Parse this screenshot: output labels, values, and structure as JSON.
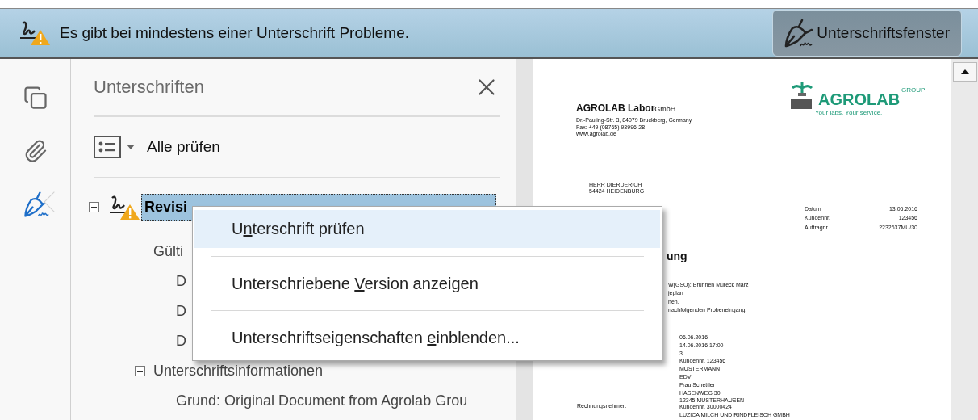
{
  "banner": {
    "message": "Es gibt bei mindestens einer Unterschrift Probleme.",
    "button": "Unterschriftsfenster"
  },
  "rail": [
    {
      "kind": "pages",
      "selected": false
    },
    {
      "kind": "attachments",
      "selected": false
    },
    {
      "kind": "signatures",
      "selected": true
    }
  ],
  "panel": {
    "title": "Unterschriften",
    "toolbar": {
      "label": "Alle prüfen"
    },
    "tree": [
      {
        "label": "Revisi",
        "selected": true,
        "expanded": true,
        "warning": true,
        "children": [
          {
            "label": "Gülti",
            "children": [
              {
                "label": "D"
              },
              {
                "label": "D"
              },
              {
                "label": "D"
              }
            ]
          },
          {
            "label": "Unterschriftsinformationen",
            "expanded": true,
            "children": [
              {
                "label": "Grund: Original Document from Agrolab Grou"
              }
            ]
          }
        ]
      }
    ]
  },
  "context_menu": [
    {
      "parts": [
        "U",
        "n",
        "terschrift prüfen"
      ],
      "selected": true
    },
    {
      "parts": [
        "Unterschriebene ",
        "V",
        "ersion anzeigen"
      ],
      "selected": false
    },
    {
      "parts": [
        "Unterschriftseigenschaften ",
        "e",
        "inblenden..."
      ],
      "selected": false
    }
  ],
  "document": {
    "sender": {
      "name": "AGROLAB Labor",
      "suffix": "GmbH",
      "lines": [
        "Dr.-Pauling-Str. 3, 84079 Bruckberg, Germany",
        "Fax: +49 (08765) 93996-28",
        "www.agrolab.de"
      ]
    },
    "logo": {
      "name": "AGROLAB",
      "suffix": "GROUP",
      "tagline": "Your labs. Your service."
    },
    "recipient": [
      "HERR DIERDERICH",
      "54424 HEIDENBURG"
    ],
    "meta": [
      {
        "label": "Datum",
        "value": "13.06.2016"
      },
      {
        "label": "Kundennr.",
        "value": "123456"
      },
      {
        "label": "Auftragnr.",
        "value": "2232637MU/30"
      }
    ],
    "heading": "ung",
    "body": [
      "W(GSO): Brunnen Mureck März",
      "jeplan",
      "nen,",
      "nachfolgenden Probeneingang:"
    ],
    "details": [
      "06.06.2016",
      "14.06.2016 17:00",
      "3",
      "Kundennr. 123456",
      "MUSTERMANN",
      "EDV",
      "Frau Schettler",
      "HASENWEG 30",
      "12345 MUSTERHAUSEN"
    ],
    "bill_label": "Rechnungsnehmer:",
    "bill_values": [
      "Kundennr. 30000424",
      "LUZICA MILCH UND RINDFLEISCH GMBH"
    ]
  }
}
